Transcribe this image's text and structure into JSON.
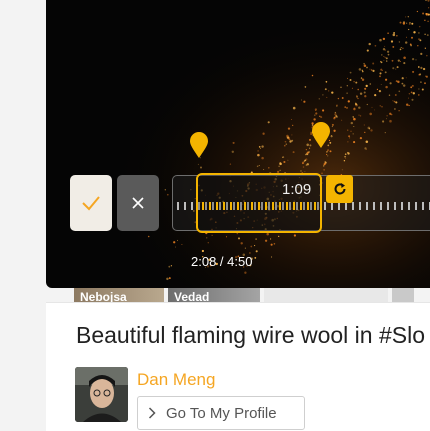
{
  "player": {
    "trim_duration": "1:09",
    "playback_time": "2:08 / 4:50",
    "accent_color": "#f4b400"
  },
  "controls": {
    "confirm_icon": "checkmark-icon",
    "cancel_icon": "close-icon",
    "loop_icon": "refresh-icon",
    "marker_icon": "map-pin-icon"
  },
  "thumbnails": [
    {
      "label": "Nebojsa"
    },
    {
      "label": "Vedad"
    }
  ],
  "video_info": {
    "title": "Beautiful flaming wire wool in #Slo",
    "author": "Dan Meng",
    "author_color": "#f5a623",
    "profile_button": "Go To My Profile"
  }
}
